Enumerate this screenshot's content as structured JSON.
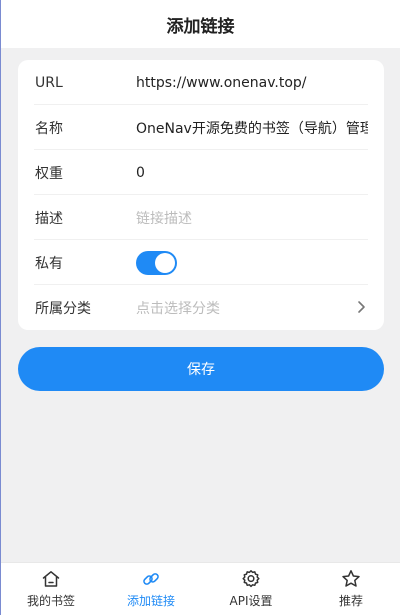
{
  "header": {
    "title": "添加链接"
  },
  "form": {
    "rows": [
      {
        "label": "URL",
        "value": "https://www.onenav.top/"
      },
      {
        "label": "名称",
        "value": "OneNav开源免费的书签（导航）管理"
      },
      {
        "label": "权重",
        "value": "0"
      },
      {
        "label": "描述",
        "placeholder": "链接描述"
      },
      {
        "label": "私有",
        "toggle_on": true
      },
      {
        "label": "所属分类",
        "placeholder": "点击选择分类"
      }
    ]
  },
  "save_label": "保存",
  "tabbar": {
    "tabs": [
      {
        "label": "我的书签",
        "icon": "home-icon",
        "active": false
      },
      {
        "label": "添加链接",
        "icon": "link-icon",
        "active": true
      },
      {
        "label": "API设置",
        "icon": "gear-icon",
        "active": false
      },
      {
        "label": "推荐",
        "icon": "star-icon",
        "active": false
      }
    ]
  },
  "colors": {
    "accent": "#1f8af5",
    "background": "#f0f0f1",
    "placeholder": "#bcbcbc"
  }
}
